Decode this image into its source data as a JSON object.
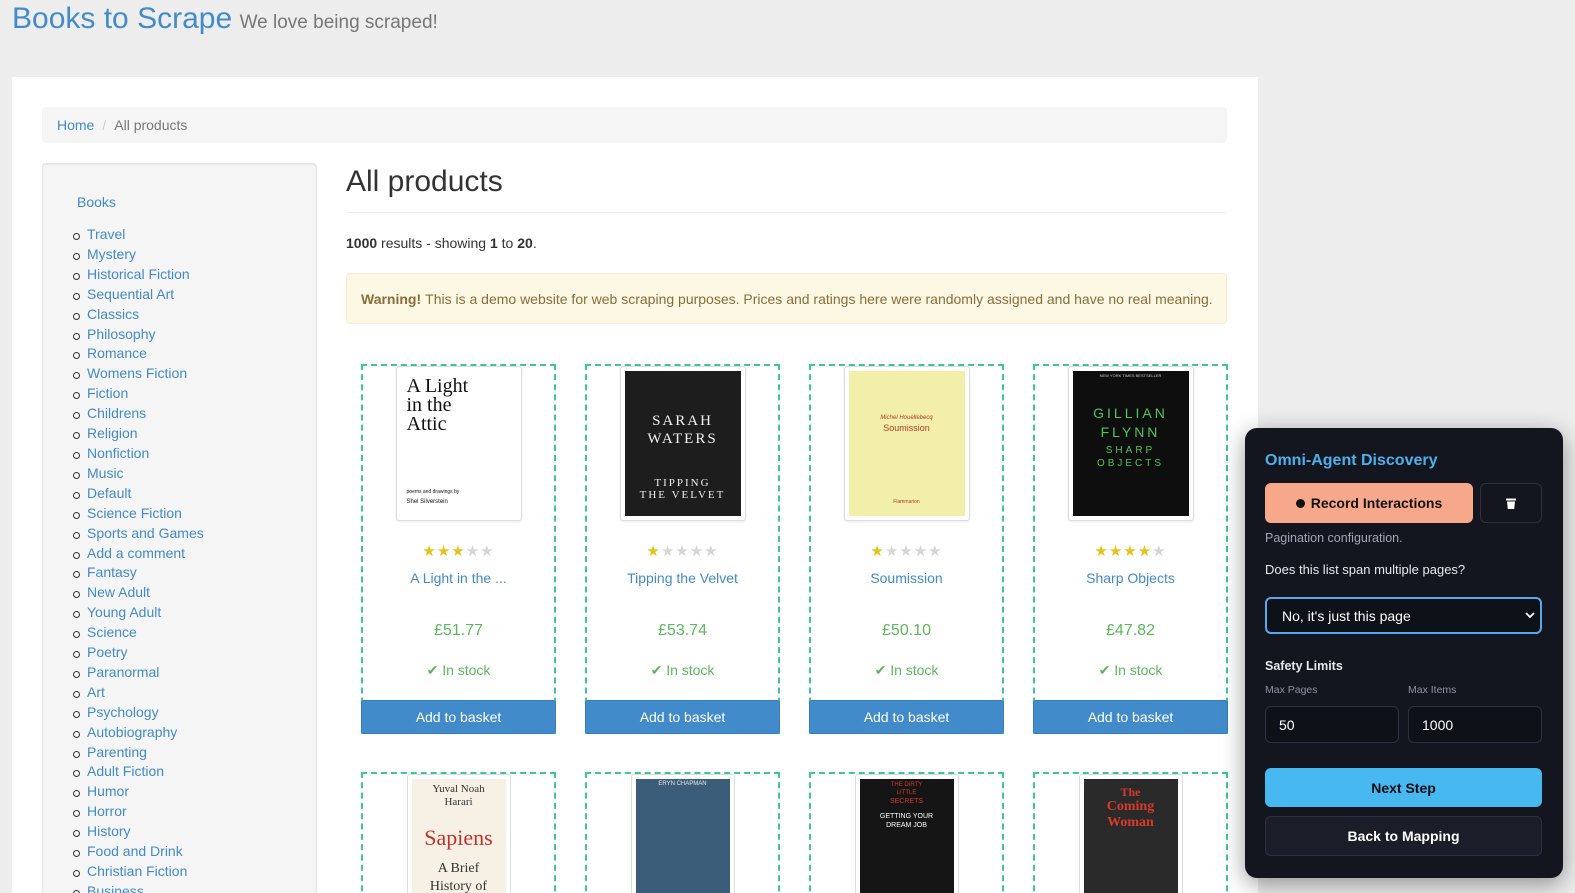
{
  "header": {
    "brand": "Books to Scrape",
    "tagline": "We love being scraped!"
  },
  "breadcrumb": {
    "home": "Home",
    "current": "All products"
  },
  "sidebar": {
    "title": "Books",
    "categories": [
      "Travel",
      "Mystery",
      "Historical Fiction",
      "Sequential Art",
      "Classics",
      "Philosophy",
      "Romance",
      "Womens Fiction",
      "Fiction",
      "Childrens",
      "Religion",
      "Nonfiction",
      "Music",
      "Default",
      "Science Fiction",
      "Sports and Games",
      "Add a comment",
      "Fantasy",
      "New Adult",
      "Young Adult",
      "Science",
      "Poetry",
      "Paranormal",
      "Art",
      "Psychology",
      "Autobiography",
      "Parenting",
      "Adult Fiction",
      "Humor",
      "Horror",
      "History",
      "Food and Drink",
      "Christian Fiction",
      "Business"
    ]
  },
  "main": {
    "title": "All products",
    "results_total": "1000",
    "results_mid": " results - showing ",
    "results_from": "1",
    "results_to_word": " to ",
    "results_to": "20",
    "results_end": ".",
    "warning_label": "Warning!",
    "warning_text": "This is a demo website for web scraping purposes. Prices and ratings here were randomly assigned and have no real meaning."
  },
  "products": [
    {
      "title": "A Light in the ...",
      "price": "£51.77",
      "rating": 3,
      "stock": "In stock",
      "basket": "Add to basket",
      "cover": {
        "bg": "#ffffff",
        "fg": "#111111",
        "line1": "A Light",
        "line2": "in the",
        "line3": "Attic",
        "small1": "poems and drawings by",
        "small2": "Shel Silverstein"
      }
    },
    {
      "title": "Tipping the Velvet",
      "price": "£53.74",
      "rating": 1,
      "stock": "In stock",
      "basket": "Add to basket",
      "cover": {
        "bg": "#1d1d1d",
        "fg": "#f2f2f2",
        "line1": "SARAH",
        "line2": "WATERS",
        "line3": "TIPPING",
        "line4": "THE VELVET"
      }
    },
    {
      "title": "Soumission",
      "price": "£50.10",
      "rating": 1,
      "stock": "In stock",
      "basket": "Add to basket",
      "cover": {
        "bg": "#f1efa9",
        "fg": "#b63a2a",
        "line1": "Michel Houellebecq",
        "line2": "Soumission",
        "small1": "Flammarion"
      }
    },
    {
      "title": "Sharp Objects",
      "price": "£47.82",
      "rating": 4,
      "stock": "In stock",
      "basket": "Add to basket",
      "cover": {
        "bg": "#0e0e0e",
        "fg": "#51c45a",
        "line1": "GILLIAN",
        "line2": "FLYNN",
        "line3": "SHARP",
        "line4": "OBJECTS",
        "small1": "NEW YORK TIMES BESTSELLER"
      }
    }
  ],
  "products_row2": [
    {
      "cover": {
        "bg": "#f6f1e4",
        "fg": "#c4302b",
        "line1": "Yuval Noah",
        "line2": "Harari",
        "line3": "Sapiens",
        "line4": "A Brief",
        "line5": "History of"
      }
    },
    {
      "cover": {
        "bg": "#3b5d7a",
        "fg": "#e3e9ef",
        "line1": "ERYN CHAPMAN"
      }
    },
    {
      "cover": {
        "bg": "#151515",
        "fg": "#ffffff",
        "line1": "THE DIRTY",
        "line2": "LITTLE",
        "line3": "SECRETS",
        "line4": "GETTING YOUR",
        "line5": "DREAM JOB"
      }
    },
    {
      "cover": {
        "bg": "#2a2a2a",
        "fg": "#d93a2b",
        "line1": "The",
        "line2": "Coming",
        "line3": "Woman"
      }
    }
  ],
  "panel": {
    "title": "Omni-Agent Discovery",
    "record": "Record Interactions",
    "subtitle": "Pagination configuration.",
    "question": "Does this list span multiple pages?",
    "select_value": "No, it's just this page",
    "safety": "Safety Limits",
    "max_pages_label": "Max Pages",
    "max_pages": "50",
    "max_items_label": "Max Items",
    "max_items": "1000",
    "next": "Next Step",
    "back": "Back to Mapping",
    "accent": "#4cb1ea",
    "record_color": "#f8a88a",
    "next_color": "#47b9f0"
  }
}
